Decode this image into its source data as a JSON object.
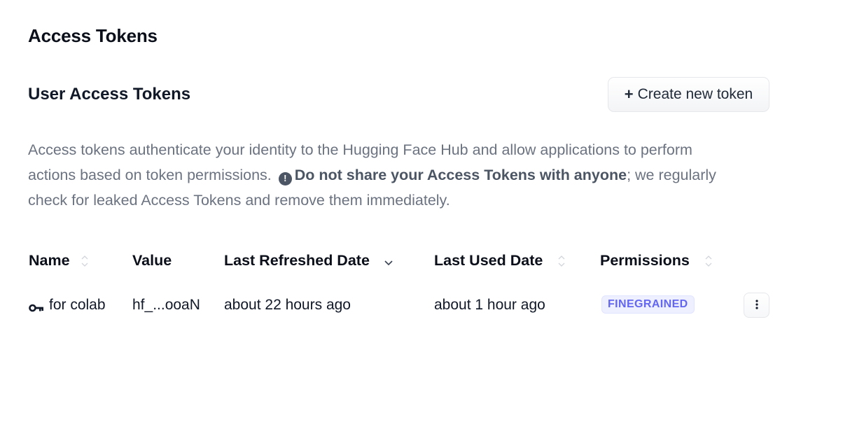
{
  "page": {
    "title": "Access Tokens"
  },
  "section": {
    "title": "User Access Tokens",
    "create_button_plus": "+",
    "create_button_label": "Create new token"
  },
  "description": {
    "part1": "Access tokens authenticate your identity to the Hugging Face Hub and allow applications to perform actions based on token permissions.",
    "warning_icon": "!",
    "bold_part": "Do not share your Access Tokens with anyone",
    "part2": "; we regularly check for leaked Access Tokens and remove them immediately."
  },
  "table": {
    "columns": [
      {
        "label": "Name",
        "sortable": true,
        "sort": "none"
      },
      {
        "label": "Value",
        "sortable": false
      },
      {
        "label": "Last Refreshed Date",
        "sortable": true,
        "sort": "desc"
      },
      {
        "label": "Last Used Date",
        "sortable": true,
        "sort": "none"
      },
      {
        "label": "Permissions",
        "sortable": true,
        "sort": "none"
      }
    ],
    "rows": [
      {
        "name": "for colab",
        "value": "hf_...ooaN",
        "last_refreshed": "about 22 hours ago",
        "last_used": "about 1 hour ago",
        "permission": "FINEGRAINED"
      }
    ]
  },
  "icons": {
    "key": "key-icon",
    "sort": "sort-icon",
    "sort_desc": "chevron-down-icon",
    "menu": "more-vertical-icon",
    "warning": "exclamation-circle-icon"
  },
  "colors": {
    "badge_text": "#6366f1",
    "badge_bg": "#eef0ff",
    "muted_text": "#6b7280"
  }
}
